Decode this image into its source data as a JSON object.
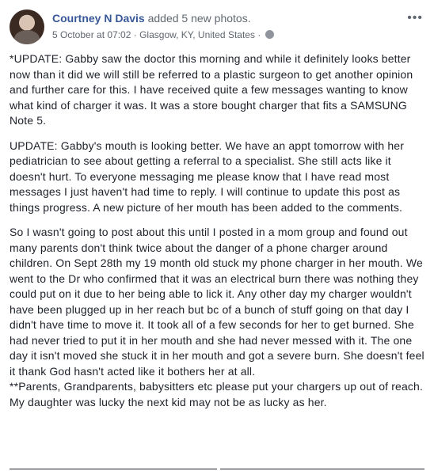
{
  "header": {
    "author": "Courtney N Davis",
    "action": "added 5 new photos.",
    "timestamp": "5 October at 07:02",
    "separator": "·",
    "location": "Glasgow, KY, United States",
    "separator2": "·",
    "more_icon": "more-horizontal-icon",
    "more_label": "•••",
    "privacy_icon": "globe-icon"
  },
  "body": {
    "paragraphs": [
      "*UPDATE: Gabby saw the doctor this morning and while it definitely looks better now than it did we will still be referred to a plastic surgeon to get another opinion and further care for this. I have received quite a few messages wanting to know what kind of charger it was. It was a store bought charger that fits a SAMSUNG Note 5.",
      "UPDATE: Gabby's mouth is looking better. We have an appt tomorrow with her pediatrician to see about getting a referral to a specialist. She still acts like it doesn't hurt. To everyone messaging me please know that I have read most messages I just haven't had time to reply. I will continue to update this post as things progress. A new picture of her mouth has been added to the comments.",
      "So I wasn't going to post about this until I posted in a mom group and found out many parents don't think twice about the danger of a phone charger around children. On Sept 28th my 19 month old stuck my phone charger in her mouth. We went to the Dr who confirmed that it was an electrical burn there was nothing they could put on it due to her being able to lick it. Any other day my charger wouldn't have been plugged up in her reach but bc of a bunch of stuff going on that day I didn't have time to move it. It took all of a few seconds for her to get burned. She had never tried to put it in her mouth and she had never messed with it. The one day it isn't moved she stuck it in her mouth and got a severe burn. She doesn't feel it thank God hasn't acted like it bothers her at all.",
      "**Parents, Grandparents, babysitters etc please put your chargers up out of reach. My daughter was lucky the next kid may not be as lucky as her."
    ]
  }
}
